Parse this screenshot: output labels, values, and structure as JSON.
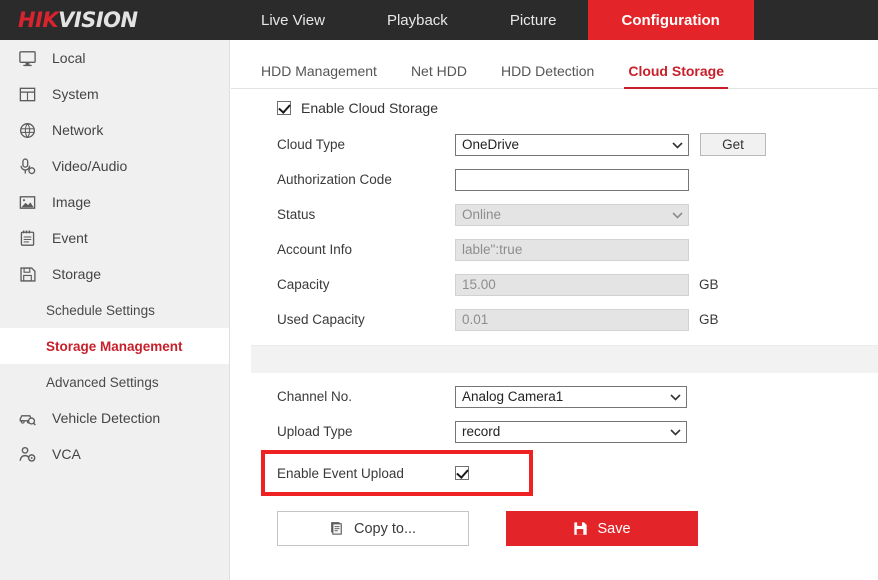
{
  "brand": {
    "part1": "HIK",
    "part2": "VISION"
  },
  "topnav": [
    {
      "label": "Live View",
      "active": false
    },
    {
      "label": "Playback",
      "active": false
    },
    {
      "label": "Picture",
      "active": false
    },
    {
      "label": "Configuration",
      "active": true
    }
  ],
  "sidebar": {
    "items": [
      {
        "label": "Local",
        "icon": "monitor-icon"
      },
      {
        "label": "System",
        "icon": "window-icon"
      },
      {
        "label": "Network",
        "icon": "globe-icon"
      },
      {
        "label": "Video/Audio",
        "icon": "microphone-icon"
      },
      {
        "label": "Image",
        "icon": "picture-icon"
      },
      {
        "label": "Event",
        "icon": "clipboard-icon"
      },
      {
        "label": "Storage",
        "icon": "floppy-icon"
      },
      {
        "label": "Schedule Settings",
        "icon": "none"
      },
      {
        "label": "Storage Management",
        "icon": "none"
      },
      {
        "label": "Advanced Settings",
        "icon": "none"
      },
      {
        "label": "Vehicle Detection",
        "icon": "car-search-icon"
      },
      {
        "label": "VCA",
        "icon": "person-gear-icon"
      }
    ]
  },
  "tabs": [
    {
      "label": "HDD Management",
      "active": false
    },
    {
      "label": "Net HDD",
      "active": false
    },
    {
      "label": "HDD Detection",
      "active": false
    },
    {
      "label": "Cloud Storage",
      "active": true
    }
  ],
  "form": {
    "enable_cloud_storage": {
      "label": "Enable Cloud Storage",
      "checked": true
    },
    "cloud_type": {
      "label": "Cloud Type",
      "value": "OneDrive"
    },
    "get_button": {
      "label": "Get"
    },
    "authorization_code": {
      "label": "Authorization Code",
      "value": "",
      "placeholder": ""
    },
    "status": {
      "label": "Status",
      "value": "Online"
    },
    "account_info": {
      "label": "Account Info",
      "value": "lable\":true"
    },
    "capacity": {
      "label": "Capacity",
      "value": "15.00",
      "unit": "GB"
    },
    "used_capacity": {
      "label": "Used Capacity",
      "value": "0.01",
      "unit": "GB"
    },
    "channel_no": {
      "label": "Channel No.",
      "value": "Analog Camera1"
    },
    "upload_type": {
      "label": "Upload Type",
      "value": "record"
    },
    "enable_event_upload": {
      "label": "Enable Event Upload",
      "checked": true
    }
  },
  "buttons": {
    "copy_to": "Copy to...",
    "save": "Save"
  },
  "colors": {
    "brand_red": "#e32428",
    "active_red": "#c8202a",
    "highlight_red": "#ee2222",
    "topbar_dark": "#2b2b2b",
    "sidebar_gray": "#f0f0f0",
    "disabled_gray": "#e4e4e4"
  }
}
